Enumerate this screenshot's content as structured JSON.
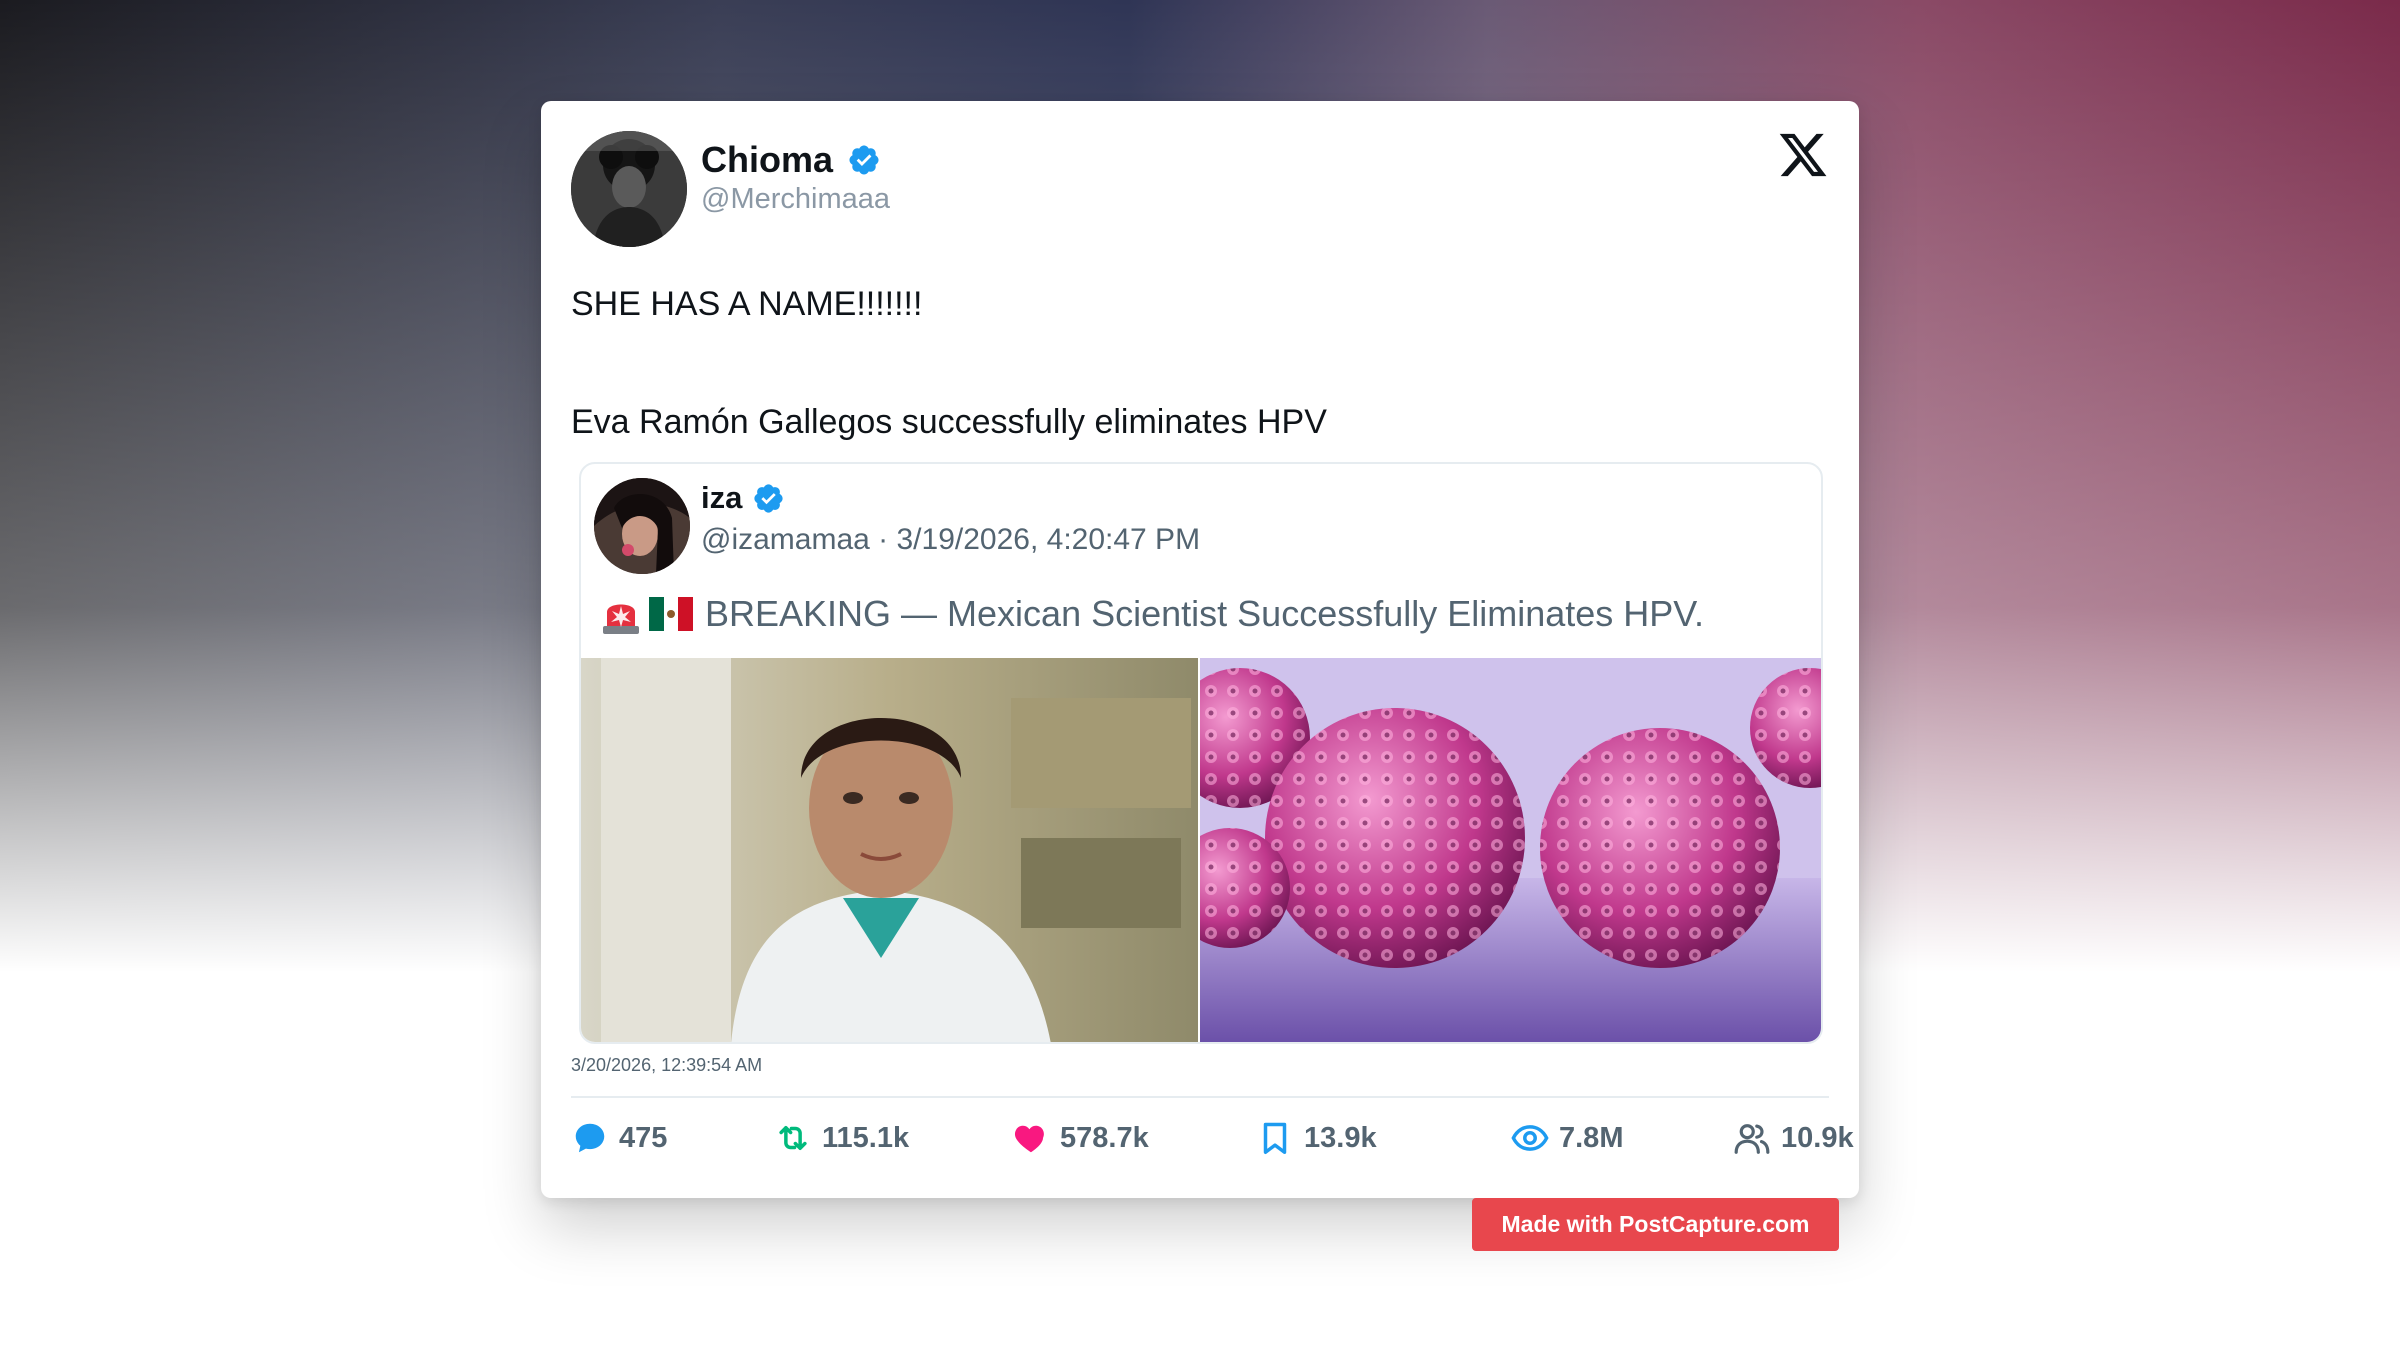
{
  "author": {
    "name": "Chioma",
    "handle": "@Merchimaaa",
    "verified": true
  },
  "tweet": {
    "text": "SHE HAS A NAME!!!!!!!\n\nEva Ramón Gallegos successfully eliminates HPV",
    "timestamp": "3/20/2026, 12:39:54 AM"
  },
  "quote": {
    "name": "iza",
    "handle": "@izamamaa",
    "meta": "@izamamaa · 3/19/2026, 4:20:47 PM",
    "verified": true,
    "text": "BREAKING — Mexican Scientist Successfully Eliminates HPV.",
    "emojis": [
      "rotating-light-icon",
      "mexico-flag-icon"
    ]
  },
  "stats": {
    "replies": "475",
    "retweets": "115.1k",
    "likes": "578.7k",
    "bookmarks": "13.9k",
    "views": "7.8M",
    "followers": "10.9k"
  },
  "colors": {
    "verified": "#1d9bf0",
    "reply": "#1d9bf0",
    "retweet": "#00ba7c",
    "like": "#f91880",
    "bookmark": "#1d9bf0",
    "views": "#1d9bf0",
    "followers": "#536471",
    "badge": "#e8474d"
  },
  "badge": {
    "label": "Made with PostCapture.com"
  }
}
